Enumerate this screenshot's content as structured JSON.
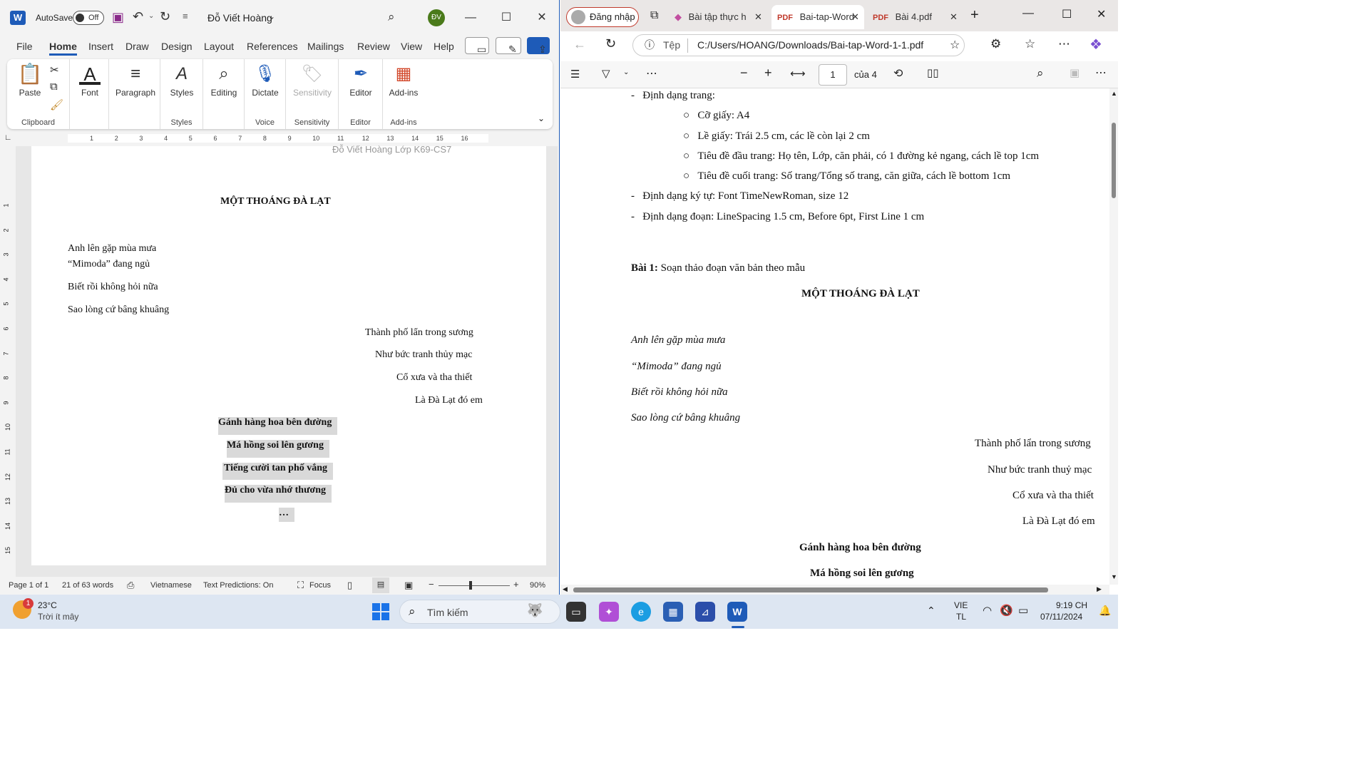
{
  "word": {
    "autosave_label": "AutoSave",
    "autosave_state": "Off",
    "user_name": "Đỗ Viết Hoàng",
    "avatar_initials": "ĐV",
    "menu": [
      "File",
      "Home",
      "Insert",
      "Draw",
      "Design",
      "Layout",
      "References",
      "Mailings",
      "Review",
      "View",
      "Help"
    ],
    "ribbon": {
      "paste": "Paste",
      "clipboard": "Clipboard",
      "font": "Font",
      "paragraph": "Paragraph",
      "styles": "Styles",
      "styles_group": "Styles",
      "editing": "Editing",
      "dictate": "Dictate",
      "voice": "Voice",
      "sensitivity": "Sensitivity",
      "sensitivity_group": "Sensitivity",
      "editor": "Editor",
      "editor_group": "Editor",
      "addins": "Add-ins",
      "addins_group": "Add-ins"
    },
    "ruler_numbers": [
      "1",
      "2",
      "3",
      "4",
      "5",
      "6",
      "7",
      "8",
      "9",
      "10",
      "11",
      "12",
      "13",
      "14",
      "15",
      "16"
    ],
    "vruler_numbers": [
      "1",
      "2",
      "3",
      "4",
      "5",
      "6",
      "7",
      "8",
      "9",
      "10",
      "11",
      "12",
      "13",
      "14",
      "15"
    ],
    "doc": {
      "header_text": "Đỗ Viết Hoàng Lớp K69-CS7",
      "title": "MỘT THOÁNG ĐÀ LẠT",
      "left_lines": [
        "Anh lên gặp mùa mưa",
        "“Mimoda” đang ngủ",
        "Biết rồi không hỏi nữa",
        "Sao lòng cứ bâng khuâng"
      ],
      "right_lines": [
        "Thành phố lẩn trong sương",
        "Như bức tranh thủy mạc",
        "Cổ xưa và tha thiết",
        "Là Đà Lạt đó em"
      ],
      "center_lines": [
        "Gánh hàng hoa bên đường",
        "Má hồng soi lên gương",
        "Tiếng cười tan phố vắng",
        "Đủ cho vừa nhớ thương",
        "…"
      ]
    },
    "status": {
      "page": "Page 1 of 1",
      "words": "21 of 63 words",
      "language": "Vietnamese",
      "predictions": "Text Predictions: On",
      "focus": "Focus",
      "zoom": "90%"
    }
  },
  "edge": {
    "signin": "Đăng nhập",
    "tabs": [
      "Bài tập thực h",
      "Bai-tap-Word",
      "Bài 4.pdf"
    ],
    "file_label": "Tệp",
    "url": "C:/Users/HOANG/Downloads/Bai-tap-Word-1-1.pdf",
    "page_number": "1",
    "page_total": "của 4",
    "pdf": {
      "format_items": [
        "Định dạng trang:",
        "Cỡ giấy: A4",
        "Lề giấy: Trái 2.5 cm, các lề còn lại 2 cm",
        "Tiêu đề đầu trang: Họ tên, Lớp, căn phải, có 1 đường kẻ ngang, cách lề top 1cm",
        "Tiêu đề cuối trang: Số trang/Tổng số trang, căn giữa, cách lề bottom 1cm",
        "Định dạng ký tự: Font TimeNewRoman, size 12",
        "Định dạng đoạn: LineSpacing 1.5 cm, Before 6pt, First Line 1 cm"
      ],
      "exercise_label": "Bài 1:",
      "exercise_text": "Soạn thảo đoạn văn bản theo mẫu",
      "title": "MỘT THOÁNG ĐÀ LẠT",
      "italic_lines": [
        "Anh lên gặp mùa mưa",
        "“Mimoda” đang ngủ",
        "Biết rồi không hỏi nữa",
        "Sao lòng cứ bâng khuâng"
      ],
      "right_lines": [
        "Thành phố lẩn trong sương",
        "Như bức tranh thuỷ mạc",
        "Cổ xưa và tha thiết",
        "Là Đà Lạt đó em"
      ],
      "bold_lines": [
        "Gánh hàng hoa bên đường",
        "Má hồng soi lên gương"
      ]
    }
  },
  "taskbar": {
    "weather_temp": "23°C",
    "weather_desc": "Trời ít mây",
    "weather_badge": "1",
    "search": "Tìm kiếm",
    "lang_top": "VIE",
    "lang_bottom": "TL",
    "time": "9:19 CH",
    "date": "07/11/2024"
  }
}
